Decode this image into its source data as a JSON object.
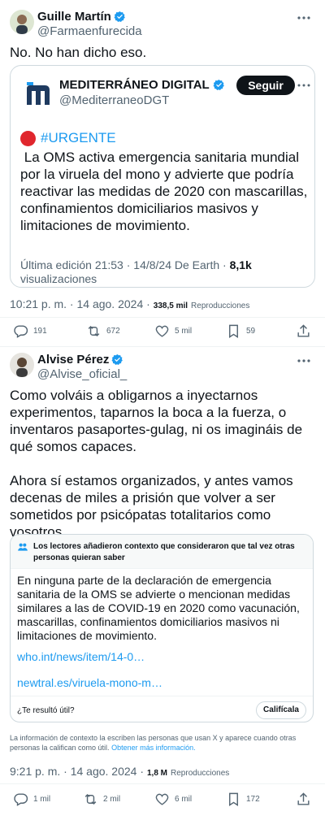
{
  "post1": {
    "author_name": "Guille Martín",
    "author_handle": "@Farmaenfurecida",
    "text": "No. No han dicho eso.",
    "quoted": {
      "account_name": "MEDITERRÁNEO DIGITAL",
      "account_handle": "@MediterraneoDGT",
      "follow_label": "Seguir",
      "hashtag": "#URGENTE",
      "text": " La OMS activa emergencia sanitaria mundial por la viruela del mono y advierte que podría reactivar las medidas de 2020 con mascarillas, confinamientos domiciliarios masivos y limitaciones de movimiento.",
      "meta_edit": "Última edición 21:53 · 14/8/24  De Earth · ",
      "meta_views": "8,1k",
      "meta_views_label": " visualizaciones"
    },
    "timestamp": "10:21 p. m. · 14 ago. 2024 ·",
    "views": "338,5 mil",
    "views_label": "Reproducciones",
    "actions": {
      "replies": "191",
      "reposts": "672",
      "likes": "5 mil",
      "bookmarks": "59"
    }
  },
  "post2": {
    "author_name": "Alvise Pérez",
    "author_handle": "@Alvise_oficial_",
    "text": "Como volváis a obligarnos a inyectarnos experimentos, taparnos la boca a la fuerza, o inventaros pasaportes-gulag, ni os imagináis de qué somos capaces.\n\nAhora sí estamos organizados, y antes vamos decenas de miles a prisión que volver a ser sometidos por psicópatas totalitarios como vosotros.",
    "note": {
      "header": "Los lectores añadieron contexto que consideraron que tal vez otras personas quieran saber",
      "text": "En ninguna parte de la declaración de emergencia sanitaria de la OMS se advierte o mencionan medidas similares a las de COVID-19 en 2020 como vacunación, mascarillas, confinamientos domiciliarios masivos ni limitaciones de movimiento.",
      "link1": "who.int/news/item/14-0…",
      "link2": "newtral.es/viruela-mono-m…",
      "helpful_question": "¿Te resultó útil?",
      "rate_label": "Califícala",
      "disclaimer": "La información de contexto la escriben las personas que usan X y aparece cuando otras personas la califican como útil. ",
      "disclaimer_link": "Obtener más información."
    },
    "timestamp": "9:21 p. m. · 14 ago. 2024 ·",
    "views": "1,8 M",
    "views_label": "Reproducciones",
    "actions": {
      "replies": "1 mil",
      "reposts": "2 mil",
      "likes": "6 mil",
      "bookmarks": "172"
    }
  },
  "colors": {
    "accent": "#1d9bf0",
    "text": "#0f1419",
    "secondary": "#536471",
    "border": "#cfd9de"
  }
}
